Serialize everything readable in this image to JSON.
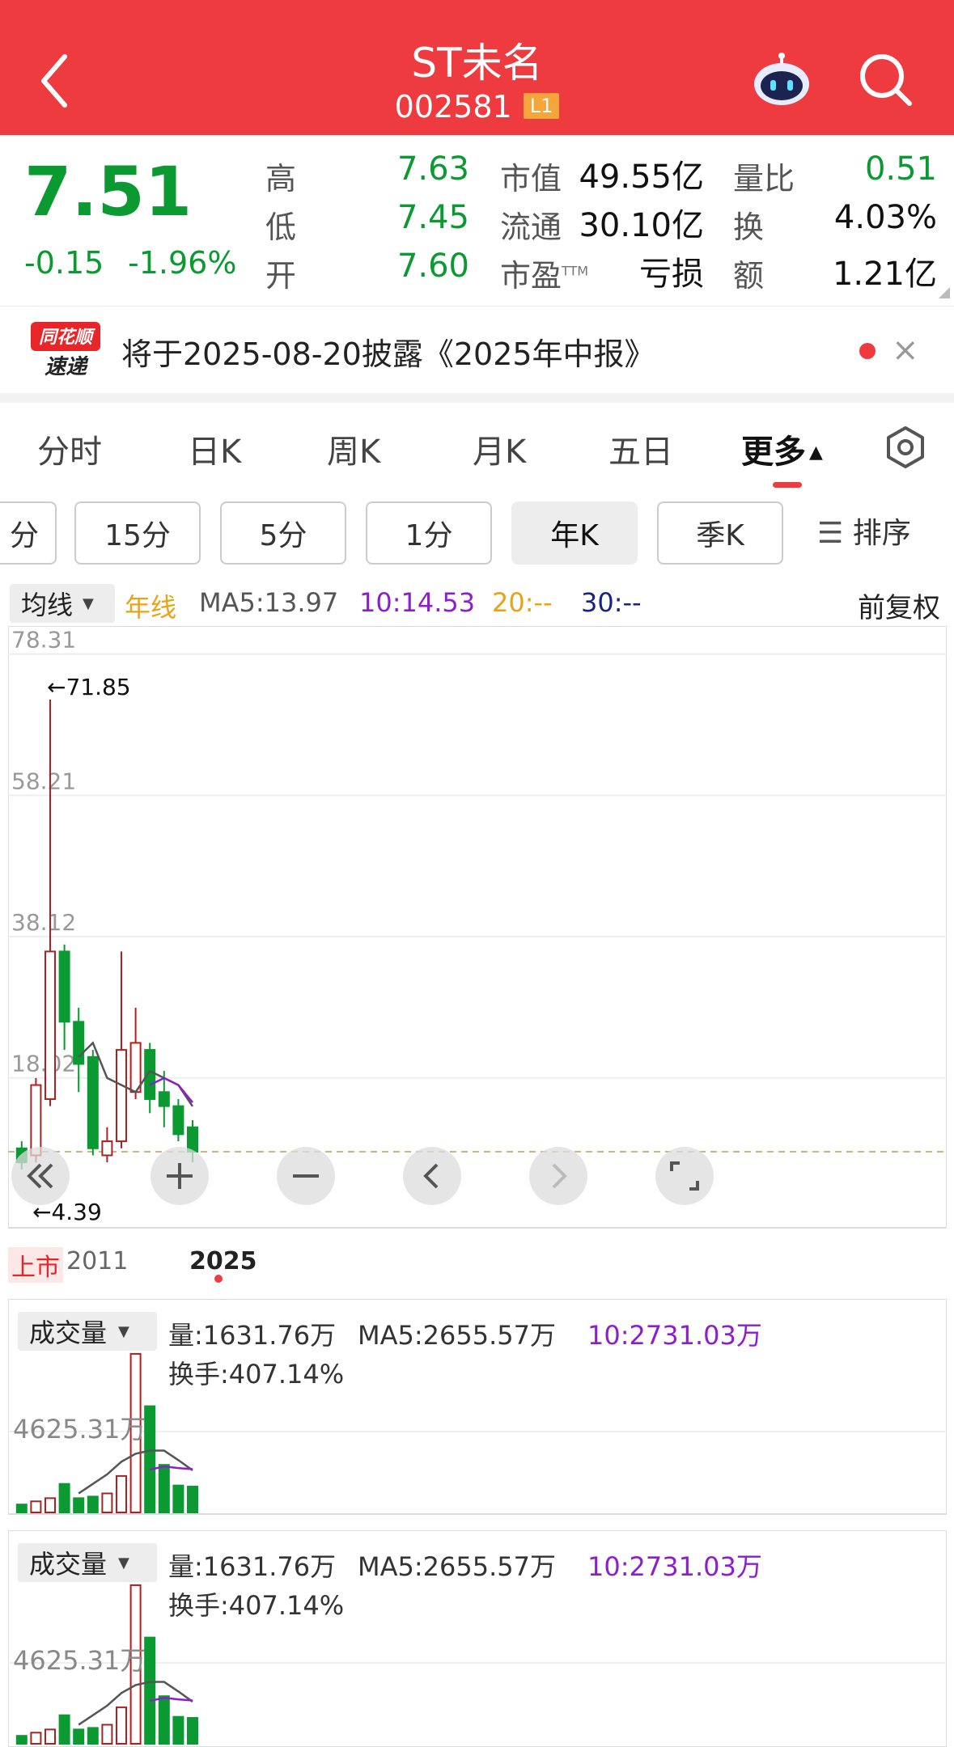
{
  "header": {
    "title": "ST未名",
    "code": "002581",
    "level": "L1"
  },
  "quote": {
    "price": "7.51",
    "change": "-0.15",
    "change_pct": "-1.96%",
    "rows": [
      {
        "l1": "高",
        "v1": "7.63",
        "l2": "市值",
        "v2": "49.55亿",
        "l3": "量比",
        "v3": "0.51"
      },
      {
        "l1": "低",
        "v1": "7.45",
        "l2": "流通",
        "v2": "30.10亿",
        "l3": "换",
        "v3": "4.03%"
      },
      {
        "l1": "开",
        "v1": "7.60",
        "l2": "市盈",
        "l2_sup": "TTM",
        "v2": "亏损",
        "l3": "额",
        "v3": "1.21亿"
      }
    ]
  },
  "news": {
    "logo_top": "同花顺",
    "logo_bottom": "速递",
    "text": "将于2025-08-20披露《2025年中报》",
    "close": "×"
  },
  "tabs": [
    "分时",
    "日K",
    "周K",
    "月K",
    "五日",
    "更多"
  ],
  "periods": [
    "分",
    "15分",
    "5分",
    "1分",
    "年K",
    "季K"
  ],
  "sort_label": "排序",
  "legend": {
    "dropdown": "均线",
    "line_label": "年线",
    "ma5": "MA5:13.97",
    "ma10": "10:14.53",
    "ma20": "20:--",
    "ma30": "30:--",
    "restore": "前复权"
  },
  "colors": {
    "brand_red": "#ee3b3f",
    "down_green": "#0b9a32",
    "up_red": "#b02020",
    "ma10_purple": "#8c1fcb",
    "ma20_yellow": "#e8a317",
    "ma30_navy": "#1a237e"
  },
  "chart_data": {
    "type": "candlestick",
    "y_ticks": [
      "78.31",
      "58.21",
      "38.12",
      "18.02"
    ],
    "ylim": [
      -1,
      80
    ],
    "high_label": "←71.85",
    "low_label": "←4.39",
    "x_labels": [
      "上市",
      "2011",
      "2025"
    ],
    "candles": [
      {
        "o": 8,
        "c": 6,
        "h": 9,
        "l": 5
      },
      {
        "o": 7,
        "c": 17,
        "h": 18,
        "l": 6
      },
      {
        "o": 15,
        "c": 36,
        "h": 71.85,
        "l": 14
      },
      {
        "o": 36,
        "c": 26,
        "h": 37,
        "l": 22
      },
      {
        "o": 26,
        "c": 20,
        "h": 28,
        "l": 16
      },
      {
        "o": 21,
        "c": 8,
        "h": 22,
        "l": 7
      },
      {
        "o": 7,
        "c": 9,
        "h": 11,
        "l": 6
      },
      {
        "o": 9,
        "c": 22,
        "h": 36,
        "l": 8
      },
      {
        "o": 16,
        "c": 23,
        "h": 28,
        "l": 15
      },
      {
        "o": 22,
        "c": 15,
        "h": 23,
        "l": 13
      },
      {
        "o": 16,
        "c": 14,
        "h": 19,
        "l": 11
      },
      {
        "o": 14,
        "c": 10,
        "h": 15,
        "l": 9
      },
      {
        "o": 11,
        "c": 7.51,
        "h": 12,
        "l": 6
      }
    ],
    "ma5": [
      null,
      null,
      null,
      null,
      21,
      23,
      18,
      17,
      16,
      19,
      18,
      17,
      13.97
    ],
    "ma10": [
      null,
      null,
      null,
      null,
      null,
      null,
      null,
      null,
      null,
      17,
      18,
      17,
      14.53
    ]
  },
  "volume_panels": [
    {
      "dropdown": "成交量",
      "vol": "量:1631.76万",
      "ma5": "MA5:2655.57万",
      "ma10": "10:2731.03万",
      "turnover": "换手:407.14%",
      "tick": "4625.31万"
    },
    {
      "dropdown": "成交量",
      "vol": "量:1631.76万",
      "ma5": "MA5:2655.57万",
      "ma10": "10:2731.03万",
      "turnover": "换手:407.14%",
      "tick": "4625.31万"
    }
  ],
  "volume_data": {
    "type": "bar",
    "values": [
      500,
      700,
      900,
      1800,
      900,
      1000,
      1200,
      2300,
      10000,
      6700,
      3000,
      1700,
      1631.76
    ],
    "ma5": [
      null,
      null,
      null,
      null,
      1200,
      1800,
      2400,
      3200,
      3700,
      3900,
      3900,
      3300,
      2655.57
    ],
    "ma10": [
      null,
      null,
      null,
      null,
      null,
      null,
      null,
      null,
      null,
      2700,
      2900,
      2800,
      2731.03
    ],
    "ylim": [
      0,
      10200
    ]
  }
}
